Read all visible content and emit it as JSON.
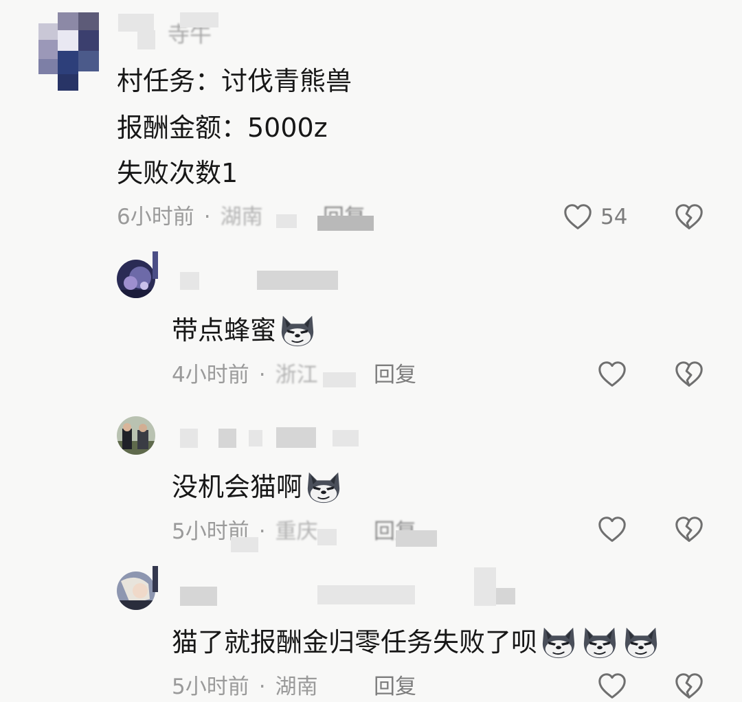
{
  "comments": [
    {
      "name_visible": "寺牛",
      "lines": [
        "村任务：讨伐青熊兽",
        "报酬金额：5000z",
        "失败次数1"
      ],
      "time": "6小时前",
      "region": "湖南",
      "reply_label": "回复",
      "likes": "54"
    },
    {
      "text": "带点蜂蜜",
      "time": "4小时前",
      "region": "浙江",
      "reply_label": "回复"
    },
    {
      "text": "没机会猫啊",
      "time": "5小时前",
      "region": "重庆",
      "reply_label": "回复"
    },
    {
      "text": "猫了就报酬金归零任务失败了呗",
      "time": "5小时前",
      "region": "湖南",
      "reply_label": "回复"
    }
  ],
  "separator": "·",
  "icons": {
    "like": "heart-outline-icon",
    "dislike": "broken-heart-icon",
    "emoji": "wolf-sticker-emoji"
  },
  "colors": {
    "text": "#171717",
    "meta": "#9a9a9a",
    "background": "#f8f8f7"
  }
}
